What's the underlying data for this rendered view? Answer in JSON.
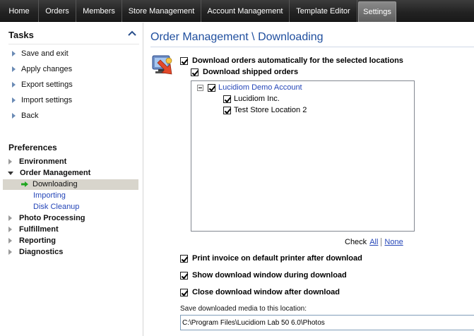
{
  "nav": {
    "tabs": [
      {
        "label": "Home"
      },
      {
        "label": "Orders"
      },
      {
        "label": "Members"
      },
      {
        "label": "Store Management"
      },
      {
        "label": "Account Management"
      },
      {
        "label": "Template Editor"
      },
      {
        "label": "Settings"
      }
    ],
    "active": "Settings"
  },
  "sidebar": {
    "tasks_title": "Tasks",
    "tasks": [
      {
        "label": "Save and exit"
      },
      {
        "label": "Apply changes"
      },
      {
        "label": "Export settings"
      },
      {
        "label": "Import settings"
      },
      {
        "label": "Back"
      }
    ],
    "preferences_title": "Preferences",
    "tree": [
      {
        "label": "Environment",
        "expanded": false
      },
      {
        "label": "Order Management",
        "expanded": true,
        "children": [
          {
            "label": "Downloading",
            "selected": true
          },
          {
            "label": "Importing"
          },
          {
            "label": "Disk Cleanup"
          }
        ]
      },
      {
        "label": "Photo Processing",
        "expanded": false
      },
      {
        "label": "Fulfillment",
        "expanded": false
      },
      {
        "label": "Reporting",
        "expanded": false
      },
      {
        "label": "Diagnostics",
        "expanded": false
      }
    ]
  },
  "main": {
    "title": "Order Management \\ Downloading",
    "download_auto": {
      "label": "Download orders automatically for the selected locations",
      "checked": true
    },
    "download_shipped": {
      "label": "Download shipped orders",
      "checked": true
    },
    "locations": {
      "root": {
        "label": "Lucidiom Demo Account",
        "checked": true
      },
      "children": [
        {
          "label": "Lucidiom Inc.",
          "checked": true
        },
        {
          "label": "Test Store Location 2",
          "checked": true
        }
      ]
    },
    "check_label": "Check",
    "check_all": "All",
    "check_none": "None",
    "print_invoice": {
      "label": "Print invoice on default printer after download",
      "checked": true
    },
    "show_window": {
      "label": "Show download window during download",
      "checked": true
    },
    "close_window": {
      "label": "Close download window after download",
      "checked": true
    },
    "save_location_label": "Save downloaded media to this location:",
    "save_location_value": "C:\\Program Files\\Lucidiom Lab 50 6.0\\Photos"
  }
}
